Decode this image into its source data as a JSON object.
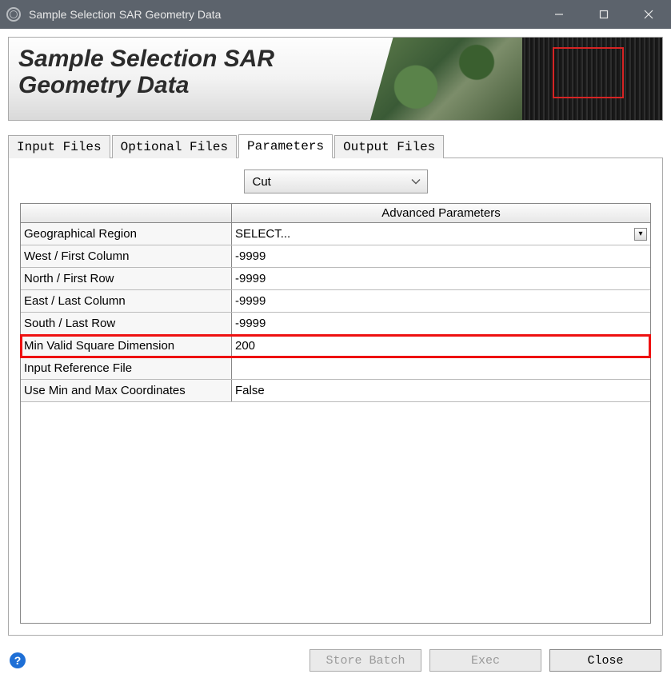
{
  "window": {
    "title": "Sample Selection SAR Geometry Data"
  },
  "banner": {
    "title": "Sample Selection SAR\nGeometry Data"
  },
  "tabs": [
    {
      "label": "Input Files",
      "active": false
    },
    {
      "label": "Optional Files",
      "active": false
    },
    {
      "label": "Parameters",
      "active": true
    },
    {
      "label": "Output Files",
      "active": false
    }
  ],
  "dropdown": {
    "selected": "Cut"
  },
  "grid": {
    "header_right": "Advanced Parameters",
    "rows": [
      {
        "label": "Geographical Region",
        "value": "SELECT...",
        "kind": "dropdown",
        "highlight": false
      },
      {
        "label": "West / First Column",
        "value": "-9999",
        "kind": "text",
        "highlight": false
      },
      {
        "label": "North / First Row",
        "value": "-9999",
        "kind": "text",
        "highlight": false
      },
      {
        "label": "East / Last Column",
        "value": "-9999",
        "kind": "text",
        "highlight": false
      },
      {
        "label": "South / Last Row",
        "value": "-9999",
        "kind": "text",
        "highlight": false
      },
      {
        "label": "Min Valid Square Dimension",
        "value": "200",
        "kind": "text",
        "highlight": true
      },
      {
        "label": "Input Reference File",
        "value": "",
        "kind": "text",
        "highlight": false
      },
      {
        "label": "Use Min and Max Coordinates",
        "value": "False",
        "kind": "text",
        "highlight": false
      }
    ]
  },
  "footer": {
    "store_batch": "Store Batch",
    "exec": "Exec",
    "close": "Close"
  }
}
